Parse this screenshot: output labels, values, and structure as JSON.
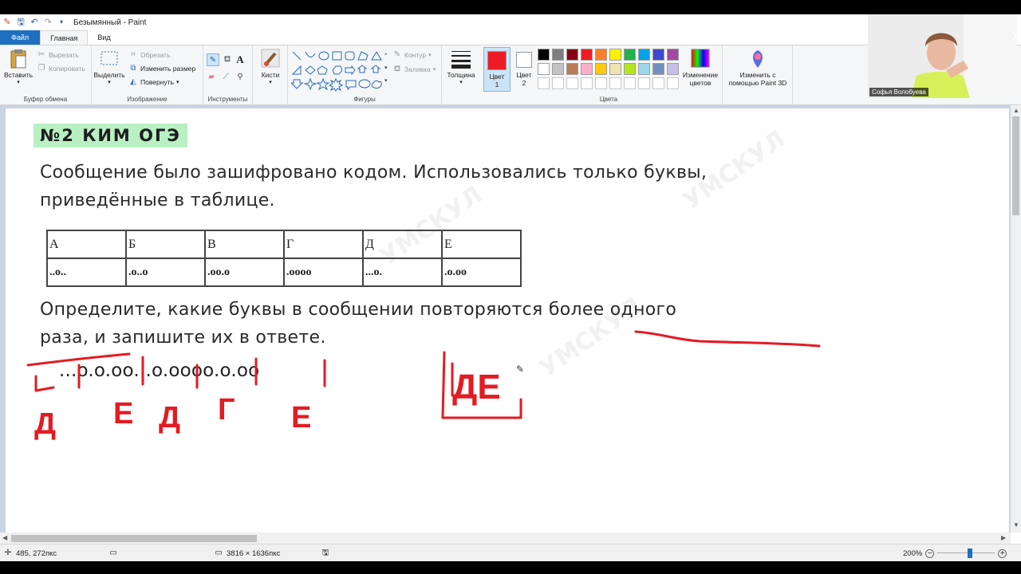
{
  "topbar": {
    "title": "Безымянный - Paint"
  },
  "tabs": [
    "Файл",
    "Главная",
    "Вид"
  ],
  "ribbon": {
    "clipboard": {
      "paste": "Вставить",
      "cut": "Вырезать",
      "copy": "Копировать",
      "label": "Буфер обмена"
    },
    "image": {
      "select": "Выделить",
      "crop": "Обрезать",
      "resize": "Изменить размер",
      "rotate": "Повернуть",
      "label": "Изображение"
    },
    "tools": {
      "label": "Инструменты"
    },
    "brushes": {
      "label": "Кисти"
    },
    "shapes": {
      "outline": "Контур",
      "fill": "Заливка",
      "label": "Фигуры"
    },
    "size": {
      "label": "Толщина"
    },
    "color1": {
      "label": "Цвет 1",
      "color": "#ed1c24"
    },
    "color2": {
      "label": "Цвет 2",
      "color": "#ffffff"
    },
    "colors": {
      "label": "Цвета",
      "row1": [
        "#000000",
        "#7f7f7f",
        "#880015",
        "#ed1c24",
        "#ff7f27",
        "#fff200",
        "#22b14c",
        "#00a2e8",
        "#3f48cc",
        "#a349a4"
      ],
      "row2": [
        "#ffffff",
        "#c3c3c3",
        "#b97a57",
        "#ffaec9",
        "#ffc90e",
        "#efe4b0",
        "#b5e61d",
        "#99d9ea",
        "#7092be",
        "#c8bfe7"
      ]
    },
    "edit_colors": "Изменение цветов",
    "paint3d": "Изменить с помощью Paint 3D"
  },
  "webcam": {
    "name": "Софья Волобуева"
  },
  "canvas": {
    "task_num": "№2  КИМ ОГЭ",
    "line1": "Сообщение было зашифровано кодом. Использовались только буквы,",
    "line2": "приведённые в таблице.",
    "table_headers": [
      "А",
      "Б",
      "В",
      "Г",
      "Д",
      "Е"
    ],
    "table_codes": [
      "..o..",
      ".o..o",
      ".oo.o",
      ".oooo",
      "...o.",
      ".o.oo"
    ],
    "question1": "Определите, какие буквы в сообщении повторяются более одного",
    "question2": "раза, и запишите их в ответе.",
    "message": "...o.o.oo...o.oooo.o.oo",
    "handwritten_letters": [
      "Д",
      "Е",
      "Д",
      "Г",
      "Е"
    ],
    "answer": "ДЕ"
  },
  "status": {
    "cursor": "485, 272пкс",
    "size": "3816 × 1636пкс",
    "zoom": "200%"
  }
}
